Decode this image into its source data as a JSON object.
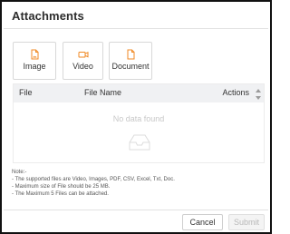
{
  "dialog": {
    "title": "Attachments"
  },
  "upload_types": [
    {
      "label": "Image",
      "icon": "image-file-icon"
    },
    {
      "label": "Video",
      "icon": "video-camera-icon"
    },
    {
      "label": "Document",
      "icon": "document-icon"
    }
  ],
  "table": {
    "columns": [
      "File",
      "File Name",
      "Actions"
    ],
    "rows": [],
    "empty_text": "No data found"
  },
  "notes": {
    "heading": "Note:-",
    "lines": [
      "- The supported files are Video, Images, PDF, CSV, Excel, Txt, Doc.",
      "- Maximum size of File should be 25 MB.",
      "- The Maximum 5 Files can be attached."
    ]
  },
  "footer": {
    "cancel_label": "Cancel",
    "submit_label": "Submit",
    "submit_disabled": true
  },
  "colors": {
    "accent_orange": "#f08a24",
    "text": "#333333",
    "header_bg": "#f0f1f3",
    "empty_text": "#c8c8c8"
  }
}
